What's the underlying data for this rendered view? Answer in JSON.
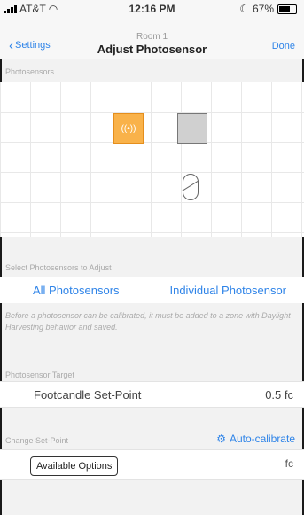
{
  "status_bar": {
    "carrier": "AT&T",
    "time": "12:16 PM",
    "battery": "67%",
    "battery_level": 0.67
  },
  "nav": {
    "back_label": "Settings",
    "subtitle": "Room 1",
    "title": "Adjust Photosensor",
    "done_label": "Done"
  },
  "photosensors": {
    "label": "Photosensors"
  },
  "select": {
    "label": "Select Photosensors to Adjust",
    "tabs": [
      "All Photosensors",
      "Individual Photosensor"
    ]
  },
  "note": "Before a photosensor can be calibrated, it must be added to a zone with Daylight Harvesting behavior and saved.",
  "target": {
    "label": "Photosensor Target",
    "row_label": "Footcandle Set-Point",
    "row_value": "0.5 fc"
  },
  "change": {
    "label": "Change Set-Point",
    "autocal_label": "Auto-calibrate",
    "options_label": "Available Options",
    "unit": "fc"
  },
  "icons": {
    "sensor_active": "wireless-sensor-icon",
    "gear": "gears-icon"
  },
  "colors": {
    "accent": "#2f84e8",
    "active_sensor": "#f9b24a"
  }
}
